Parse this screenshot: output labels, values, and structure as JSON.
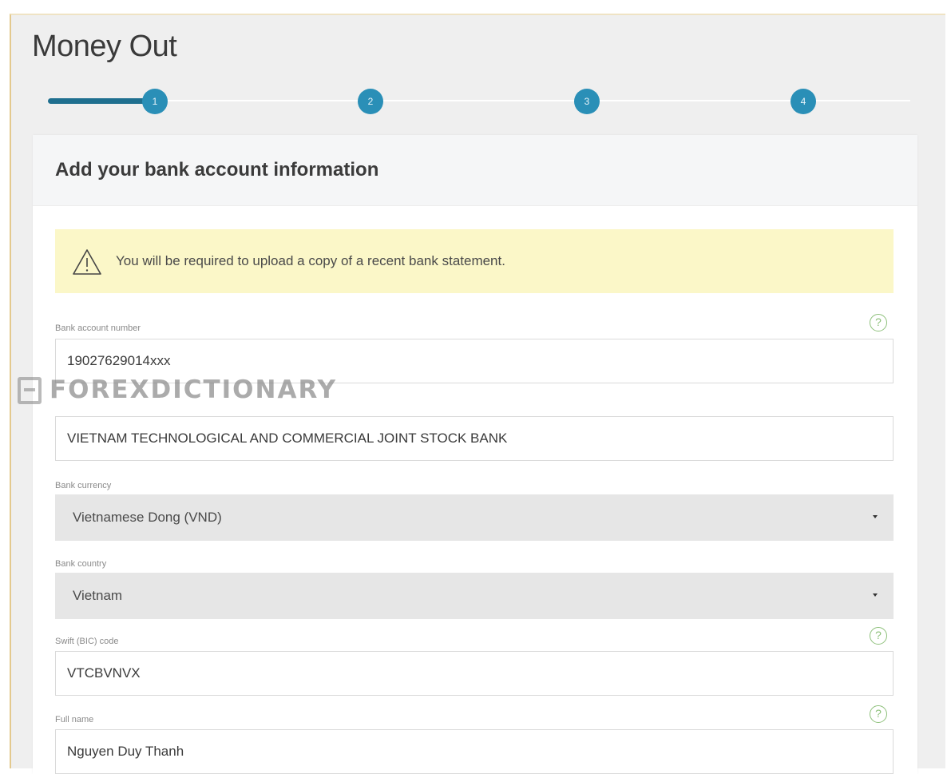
{
  "page": {
    "title": "Money Out"
  },
  "stepper": {
    "steps": [
      "1",
      "2",
      "3",
      "4"
    ],
    "current_step": 1
  },
  "card": {
    "title": "Add your bank account information"
  },
  "alert": {
    "icon": "warning-triangle-icon",
    "message": "You will be required to upload a copy of a recent bank statement."
  },
  "fields": {
    "account_number": {
      "label": "Bank account number",
      "value": "19027629014xxx"
    },
    "bank_name": {
      "value": "VIETNAM TECHNOLOGICAL AND COMMERCIAL JOINT STOCK BANK"
    },
    "currency": {
      "label": "Bank currency",
      "value": "Vietnamese Dong (VND)"
    },
    "country": {
      "label": "Bank country",
      "value": "Vietnam"
    },
    "swift": {
      "label": "Swift (BIC) code",
      "value": "VTCBVNVX"
    },
    "full_name": {
      "label": "Full name",
      "value": "Nguyen Duy Thanh"
    }
  },
  "help_icon": {
    "glyph": "?"
  },
  "watermark": {
    "text": "FOREXDICTIONARY"
  },
  "colors": {
    "accent": "#2a8fb7",
    "progress": "#1f6f8f",
    "alert_bg": "#fbf7c8",
    "help": "#8dc07a"
  }
}
